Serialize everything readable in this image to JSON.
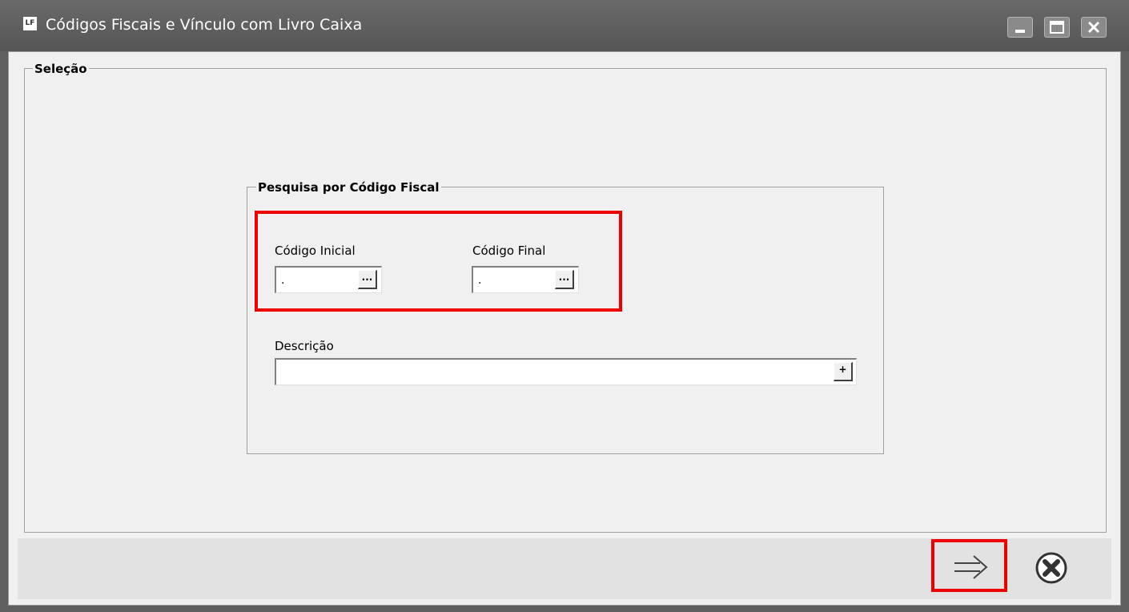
{
  "window": {
    "title": "Códigos Fiscais e Vínculo com Livro Caixa",
    "app_icon_text": "LF"
  },
  "selection_group": {
    "legend": "Seleção"
  },
  "search_group": {
    "legend": "Pesquisa por Código Fiscal",
    "codigo_inicial": {
      "label": "Código Inicial",
      "value": ".",
      "button": "..."
    },
    "codigo_final": {
      "label": "Código Final",
      "value": ".",
      "button": "..."
    },
    "descricao": {
      "label": "Descrição",
      "value": "",
      "button": "+"
    }
  },
  "footer": {
    "confirm_icon": "arrow-right-icon",
    "cancel_icon": "close-circle-icon"
  },
  "colors": {
    "highlight": "#ee0000",
    "title_bar": "#5f5f5f",
    "client_bg": "#f0f0f0"
  }
}
